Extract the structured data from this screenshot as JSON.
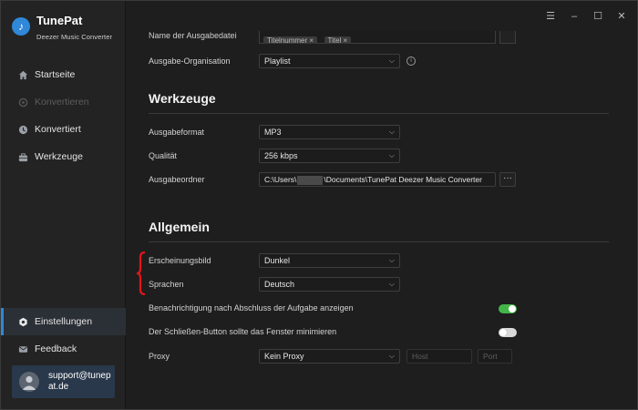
{
  "window": {
    "menu_icon": "menu-icon",
    "minimize_icon": "minimize-icon",
    "maximize_icon": "maximize-icon",
    "close_icon": "close-icon"
  },
  "brand": {
    "name": "TunePat",
    "subtitle": "Deezer Music Converter",
    "accent": "#2f88d8"
  },
  "sidebar": {
    "items": [
      {
        "label": "Startseite",
        "icon": "home-icon",
        "enabled": true
      },
      {
        "label": "Konvertieren",
        "icon": "convert-icon",
        "enabled": false
      },
      {
        "label": "Konvertiert",
        "icon": "clock-icon",
        "enabled": true
      },
      {
        "label": "Werkzeuge",
        "icon": "toolbox-icon",
        "enabled": true
      }
    ],
    "bottom_items": [
      {
        "label": "Einstellungen",
        "icon": "settings-icon",
        "active": true
      },
      {
        "label": "Feedback",
        "icon": "mail-icon",
        "active": false
      }
    ],
    "user": {
      "email": "support@tunepat.de",
      "avatar_icon": "user-avatar-icon"
    }
  },
  "settings": {
    "partial_row": {
      "label": "Name der Ausgabedatei",
      "tags": [
        "Titelnummer ×",
        "Titel ×"
      ]
    },
    "output_org": {
      "label": "Ausgabe-Organisation",
      "value": "Playlist"
    },
    "tools": {
      "title": "Werkzeuge",
      "format": {
        "label": "Ausgabeformat",
        "value": "MP3"
      },
      "quality": {
        "label": "Qualität",
        "value": "256 kbps"
      },
      "folder": {
        "label": "Ausgabeordner",
        "path_prefix": "C:\\Users\\",
        "path_suffix": "\\Documents\\TunePat Deezer Music Converter",
        "button": "···"
      }
    },
    "general": {
      "title": "Allgemein",
      "appearance": {
        "label": "Erscheinungsbild",
        "value": "Dunkel"
      },
      "language": {
        "label": "Sprachen",
        "value": "Deutsch"
      },
      "notify": {
        "label": "Benachrichtigung nach Abschluss der Aufgabe anzeigen",
        "on": true
      },
      "close_min": {
        "label": "Der Schließen-Button sollte das Fenster minimieren",
        "on": false
      },
      "proxy": {
        "label": "Proxy",
        "value": "Kein Proxy",
        "host_placeholder": "Host",
        "port_placeholder": "Port"
      }
    }
  },
  "colors": {
    "toggle_on": "#43b649",
    "annotation": "#e0161b"
  }
}
